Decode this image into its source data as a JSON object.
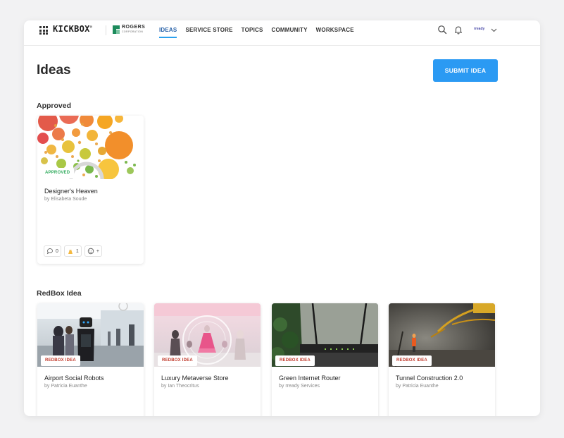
{
  "header": {
    "brand": "KICKBOX",
    "brand_mark": "®",
    "partner_name": "ROGERS",
    "partner_sub": "CORPORATION",
    "account_label": "rready",
    "nav": [
      {
        "label": "IDEAS",
        "active": true
      },
      {
        "label": "SERVICE STORE",
        "active": false
      },
      {
        "label": "TOPICS",
        "active": false
      },
      {
        "label": "COMMUNITY",
        "active": false
      },
      {
        "label": "WORKSPACE",
        "active": false
      }
    ]
  },
  "page": {
    "title": "Ideas",
    "submit_label": "SUBMIT IDEA"
  },
  "approved": {
    "heading": "Approved",
    "cards": [
      {
        "badge": "APPROVED",
        "title": "Designer's Heaven",
        "author": "by Elisabeta Soude",
        "comments": "0",
        "votes": "1",
        "add_reaction": "+"
      }
    ]
  },
  "redbox": {
    "heading": "RedBox Idea",
    "cards": [
      {
        "badge": "REDBOX IDEA",
        "title": "Airport Social Robots",
        "author": "by Patricia Euanthe"
      },
      {
        "badge": "REDBOX IDEA",
        "title": "Luxury Metaverse Store",
        "author": "by Ian Theocritus"
      },
      {
        "badge": "REDBOX IDEA",
        "title": "Green Internet Router",
        "author": "by rready Services"
      },
      {
        "badge": "REDBOX IDEA",
        "title": "Tunnel Construction 2.0",
        "author": "by Patricia Euanthe"
      }
    ]
  },
  "colors": {
    "accent": "#2b9af3",
    "approved": "#2eaa5b",
    "redbox": "#c0392b"
  }
}
